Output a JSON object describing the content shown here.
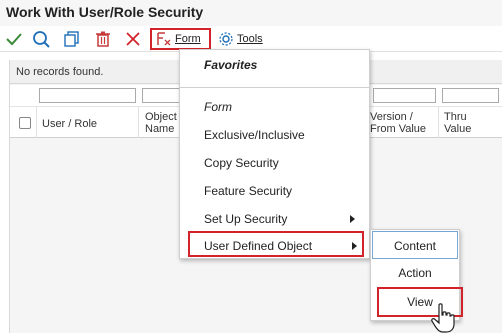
{
  "window": {
    "title": "Work With User/Role Security"
  },
  "toolbar": {
    "icons": [
      "check-icon",
      "search-icon",
      "copy-icon",
      "delete-icon",
      "close-icon"
    ],
    "form_label": "Form",
    "tools_label": "Tools"
  },
  "grid": {
    "status": "No records found.",
    "columns": [
      "User / Role",
      "Object Name",
      "Version / From Value",
      "Thru Value"
    ],
    "col_object_name_l1": "Object",
    "col_object_name_l2": "Name",
    "col_version_l1": "Version /",
    "col_version_l2": "From Value",
    "col_thru_l1": "Thru",
    "col_thru_l2": "Value"
  },
  "form_menu": {
    "favorites": "Favorites",
    "section": "Form",
    "items": [
      "Exclusive/Inclusive",
      "Copy Security",
      "Feature Security",
      "Set Up Security",
      "User Defined Object"
    ]
  },
  "udo_submenu": {
    "items": [
      "Content",
      "Action",
      "View"
    ]
  },
  "colors": {
    "highlight_border": "#d2232a",
    "accent_blue": "#1e6fb8"
  }
}
